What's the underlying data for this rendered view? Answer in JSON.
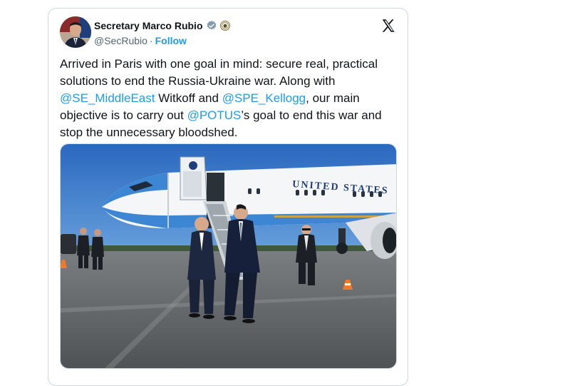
{
  "author": {
    "name": "Secretary Marco Rubio",
    "handle": "@SecRubio",
    "separator": "·",
    "follow_label": "Follow",
    "verified_badge_icon": "verified-badge-icon",
    "affiliation_icon": "us-seal-icon",
    "avatar_icon": "avatar-photo"
  },
  "brand": {
    "logo_icon": "x-logo-icon"
  },
  "tweet": {
    "segments": [
      {
        "text": "Arrived in Paris with one goal in mind: secure real, practical solutions to end the Russia-Ukraine war. Along with ",
        "mention": false
      },
      {
        "text": "@SE_MiddleEast",
        "mention": true
      },
      {
        "text": " Witkoff and ",
        "mention": false
      },
      {
        "text": "@SPE_Kellogg",
        "mention": true
      },
      {
        "text": ", our main objective is to carry out ",
        "mention": false
      },
      {
        "text": "@POTUS",
        "mention": true
      },
      {
        "text": "’s goal to end this war and stop the unnecessary bloodshed.",
        "mention": false
      }
    ]
  },
  "media": {
    "aircraft_lettering": "UNITED STATES"
  },
  "colors": {
    "accent": "#1d9bf0",
    "text": "#0f1419",
    "secondary_text": "#536471",
    "border": "#cfd9de",
    "sky": "#2f73c6",
    "plane_blue": "#3d86d4",
    "plane_white": "#f4f6f8"
  }
}
